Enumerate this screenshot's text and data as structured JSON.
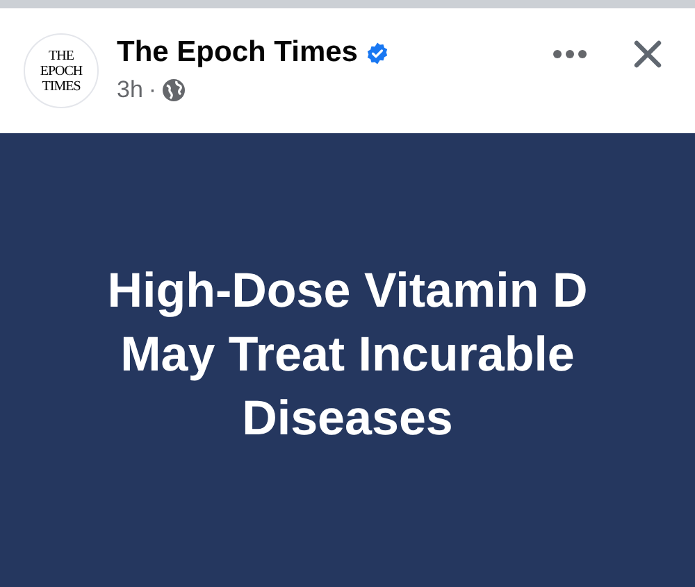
{
  "post": {
    "avatar_logo": [
      "THE",
      "EPOCH",
      "TIMES"
    ],
    "author": "The Epoch Times",
    "verified": true,
    "time": "3h",
    "separator": "·"
  },
  "image": {
    "headline": [
      "High-Dose Vitamin D",
      "May Treat Incurable",
      "Diseases"
    ]
  }
}
